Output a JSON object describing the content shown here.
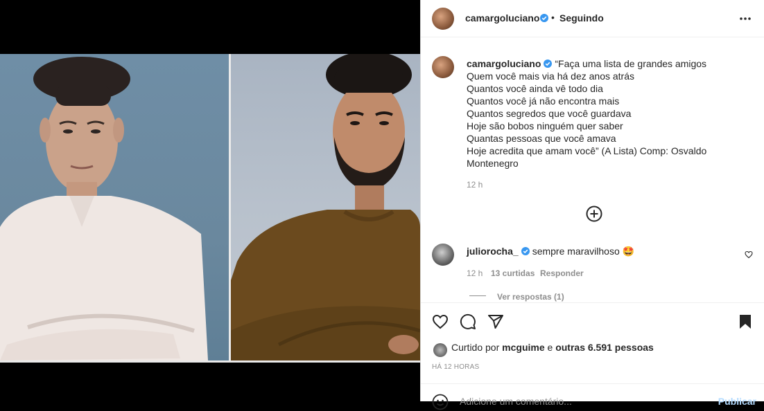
{
  "post": {
    "author": "camargoluciano",
    "separator": "•",
    "follow_status": "Seguindo",
    "caption_author": "camargoluciano",
    "caption_lines": [
      "“Faça uma lista de grandes amigos",
      "Quem você mais via há dez anos atrás",
      "Quantos você ainda vê todo dia",
      "Quantos você já não encontra mais",
      "Quantos segredos que você guardava",
      "Hoje são bobos ninguém quer saber",
      "Quantas pessoas que você amava",
      "Hoje acredita que amam você” (A Lista) Comp: Osvaldo",
      "Montenegro"
    ],
    "caption_time": "12 h"
  },
  "comment": {
    "author": "juliorocha_",
    "text": "sempre maravilhoso 🤩",
    "time": "12 h",
    "likes": "13 curtidas",
    "reply": "Responder",
    "view_replies": "Ver respostas (1)"
  },
  "likes": {
    "prefix": "Curtido por",
    "user": "mcguime",
    "middle": "e",
    "others": "outras 6.591 pessoas"
  },
  "timestamp": "HÁ 12 HORAS",
  "add_comment": {
    "placeholder": "Adicione um comentário...",
    "publish": "Publicar"
  },
  "icons": {
    "verified": "verified-badge-icon",
    "more": "more-options-icon",
    "plus": "load-more-comments-icon",
    "heart": "heart-icon",
    "comment": "comment-icon",
    "share": "share-icon",
    "save": "bookmark-icon",
    "emoji": "emoji-icon"
  },
  "colors": {
    "verified_blue": "#3897f0",
    "muted": "#8e8e8e",
    "publish_disabled": "#b3dbff",
    "sweater_brown": "#6b4a1e"
  }
}
